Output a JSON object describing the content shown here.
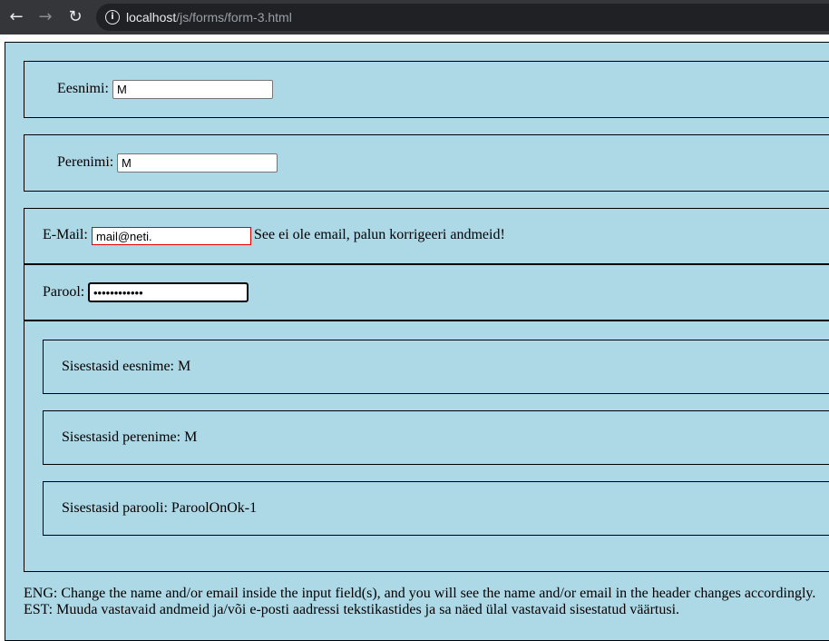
{
  "browser": {
    "url_host": "localhost",
    "url_path": "/js/forms/form-3.html"
  },
  "form": {
    "first_name": {
      "label": "Eesnimi:",
      "value": "M"
    },
    "last_name": {
      "label": "Perenimi:",
      "value": "M"
    },
    "email": {
      "label": "E-Mail:",
      "value": "mail@neti.",
      "error": "See ei ole email, palun korrigeeri andmeid!"
    },
    "password": {
      "label": "Parool:",
      "value": "ParoolOnOk-1"
    }
  },
  "output": {
    "first_name_text": "Sisestasid eesnime: M",
    "last_name_text": "Sisestasid perenime: M",
    "password_text": "Sisestasid parooli: ParoolOnOk-1"
  },
  "footer": {
    "eng": "ENG: Change the name and/or email inside the input field(s), and you will see the name and/or email in the header changes accordingly.",
    "est": "EST: Muuda vastavaid andmeid ja/või e-posti aadressi tekstikastides ja sa näed ülal vastavaid sisestatud väärtusi."
  }
}
